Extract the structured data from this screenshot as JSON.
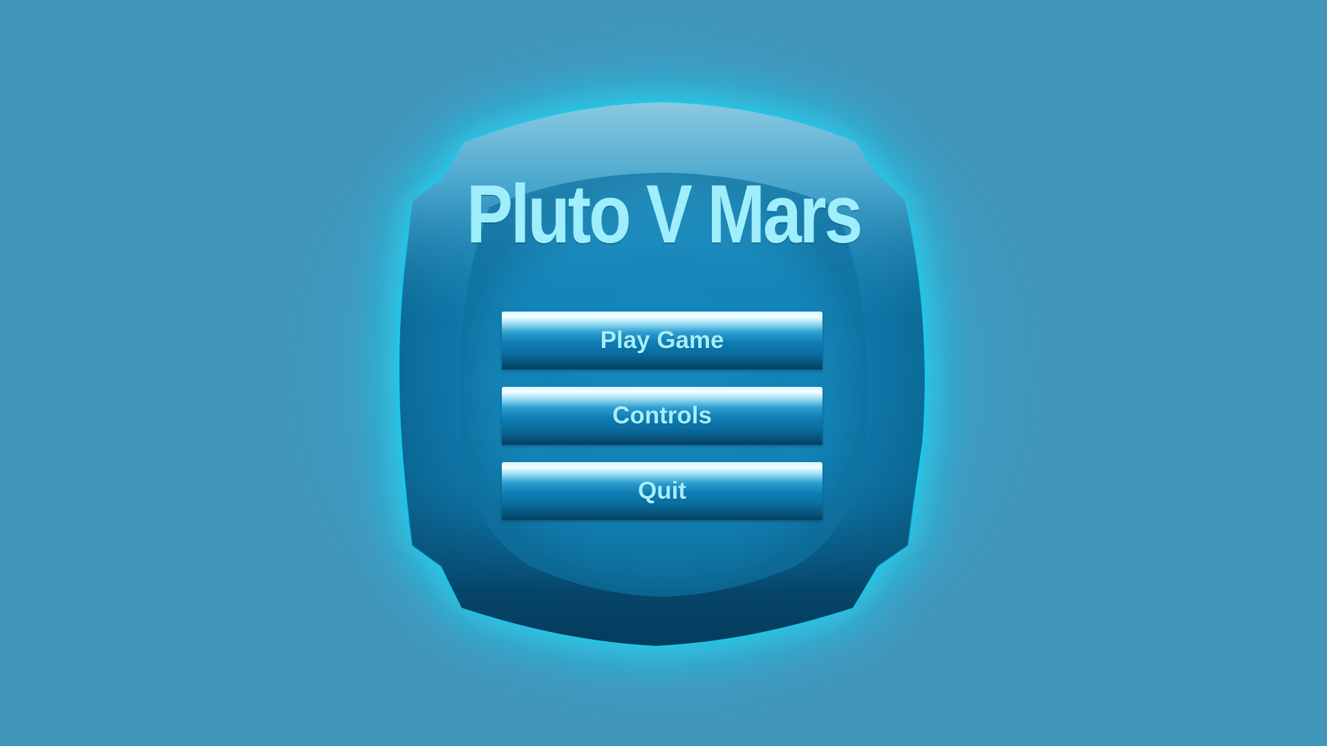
{
  "game": {
    "title": "Pluto V Mars"
  },
  "menu": {
    "play_label": "Play Game",
    "controls_label": "Controls",
    "quit_label": "Quit"
  },
  "colors": {
    "background": "#4196bb",
    "panel_glow": "#18e4ff",
    "panel_fill": "#1580b3",
    "title_text": "#9eeefc",
    "button_text": "#a6eefc"
  }
}
